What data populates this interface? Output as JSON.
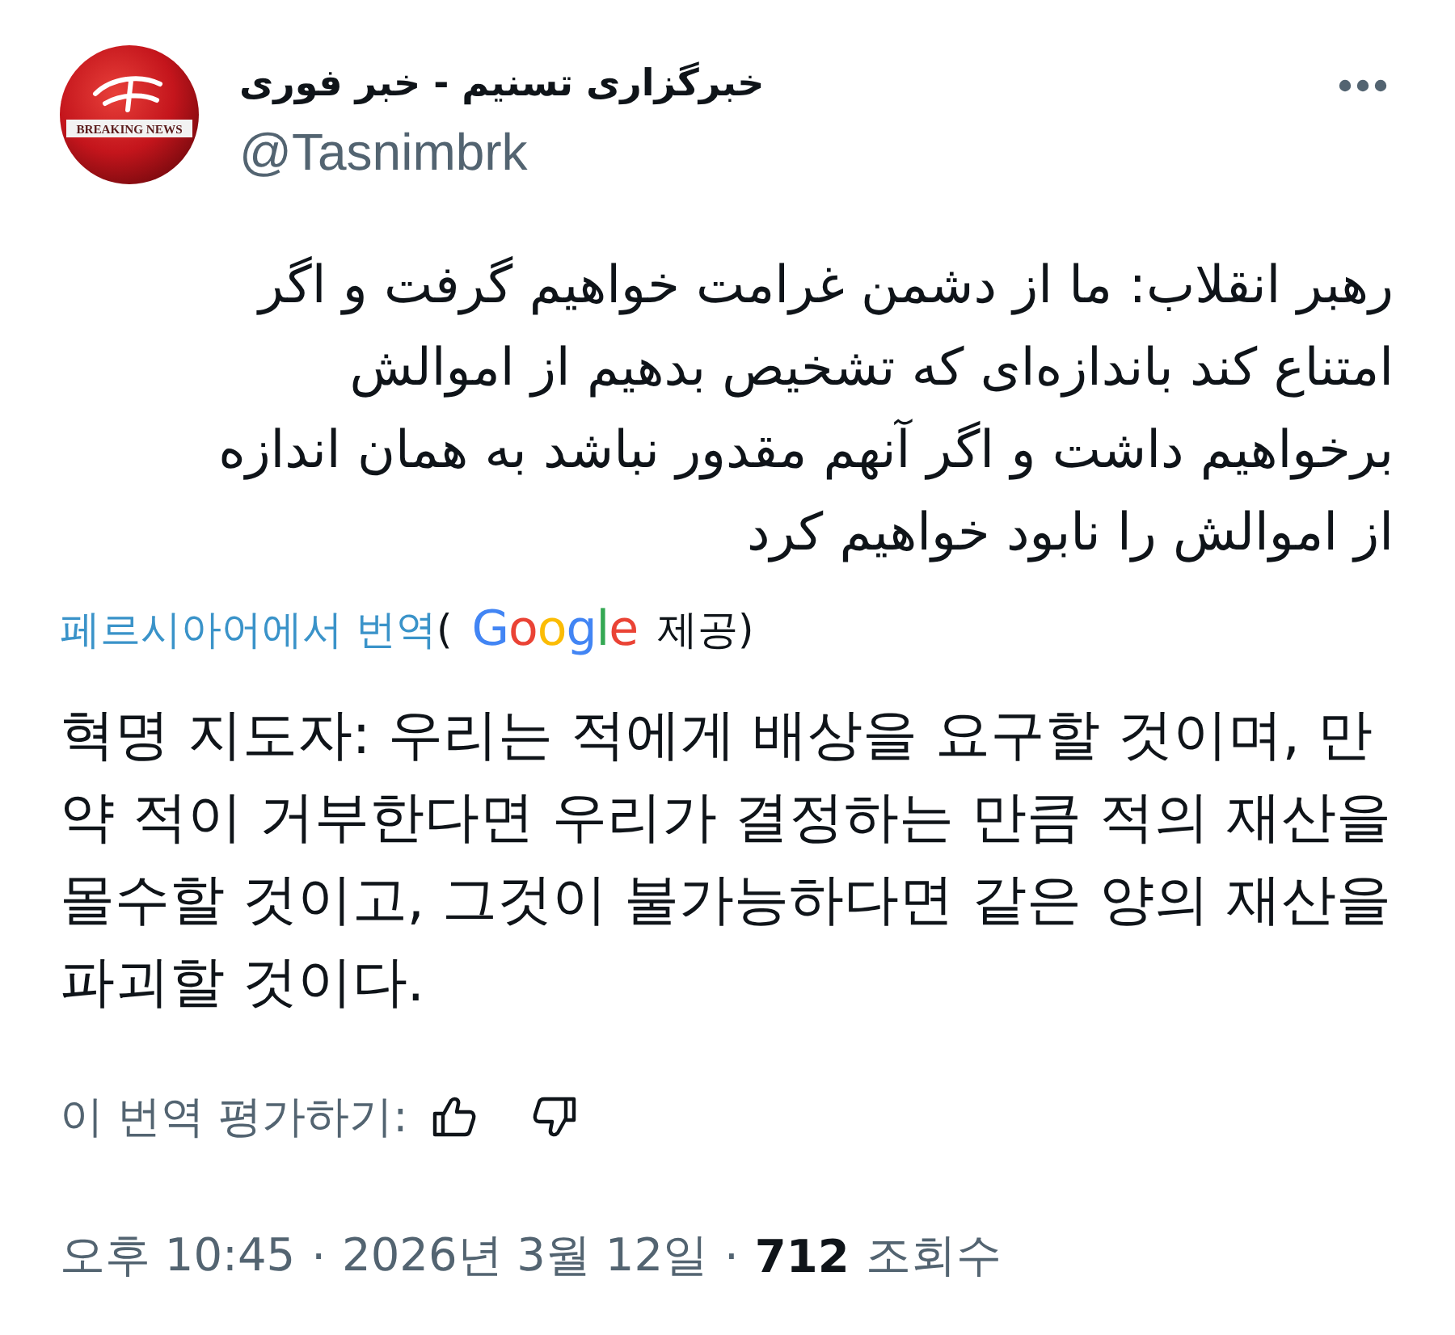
{
  "author": {
    "avatar": {
      "caption": "BREAKING NEWS"
    },
    "name": "خبرگزاری تسنیم - خبر فوری",
    "handle": "@Tasnimbrk"
  },
  "post": {
    "text": "رهبر انقلاب: ما از دشمن غرامت خواهیم گرفت و اگر امتناع کند باندازه‌ای که تشخیص بدهیم از اموالش برخواهیم داشت و اگر آنهم مقدور نباشد به همان اندازه از اموالش را نابود خواهیم کرد"
  },
  "translation": {
    "link": "페르시아어에서 번역",
    "open": "(",
    "provider": "Google",
    "close": "제공)",
    "text": "혁명 지도자: 우리는 적에게 배상을 요구할 것이며, 만약 적이 거부한다면 우리가 결정하는 만큼 적의 재산을 몰수할 것이고, 그것이 불가능하다면 같은 양의 재산을 파괴할 것이다."
  },
  "rating": {
    "label": "이 번역 평가하기:"
  },
  "meta": {
    "time": "오후 10:45",
    "separator_1": "·",
    "date": "2026년 3월 12일",
    "separator_2": "·",
    "views": "712",
    "views_label": "조회수"
  }
}
